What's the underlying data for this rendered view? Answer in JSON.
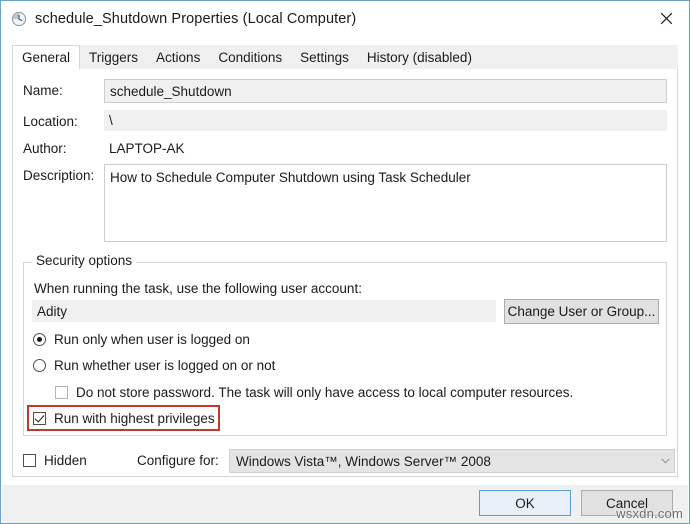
{
  "window": {
    "title": "schedule_Shutdown Properties (Local Computer)",
    "icon": "clock-schedule-icon",
    "close_label": "✕",
    "border_color": "#6aa3c4"
  },
  "tabs": [
    {
      "label": "General",
      "selected": true
    },
    {
      "label": "Triggers",
      "selected": false
    },
    {
      "label": "Actions",
      "selected": false
    },
    {
      "label": "Conditions",
      "selected": false
    },
    {
      "label": "Settings",
      "selected": false
    },
    {
      "label": "History (disabled)",
      "selected": false
    }
  ],
  "general": {
    "name_label": "Name:",
    "name_value": "schedule_Shutdown",
    "location_label": "Location:",
    "location_value": "\\",
    "author_label": "Author:",
    "author_value": "LAPTOP-AK",
    "description_label": "Description:",
    "description_value": "How to Schedule Computer Shutdown using Task Scheduler"
  },
  "security": {
    "group_title": "Security options",
    "account_prompt": "When running the task, use the following user account:",
    "account_value": "Adity",
    "change_user_button": "Change User or Group...",
    "radio_logged_on": "Run only when user is logged on",
    "radio_logged_on_checked": true,
    "radio_whether": "Run whether user is logged on or not",
    "radio_whether_checked": false,
    "check_no_password": "Do not store password.  The task will only have access to local computer resources.",
    "check_no_password_checked": false,
    "check_no_password_enabled": false,
    "check_highest": "Run with highest privileges",
    "check_highest_checked": true,
    "highlight_color": "#c0392b"
  },
  "bottom": {
    "hidden_label": "Hidden",
    "hidden_checked": false,
    "configure_label": "Configure for:",
    "configure_value": "Windows Vista™, Windows Server™ 2008",
    "configure_arrow": "⌄"
  },
  "footer": {
    "ok_label": "OK",
    "cancel_label": "Cancel"
  },
  "watermark": {
    "text": "wsxdn.com"
  }
}
